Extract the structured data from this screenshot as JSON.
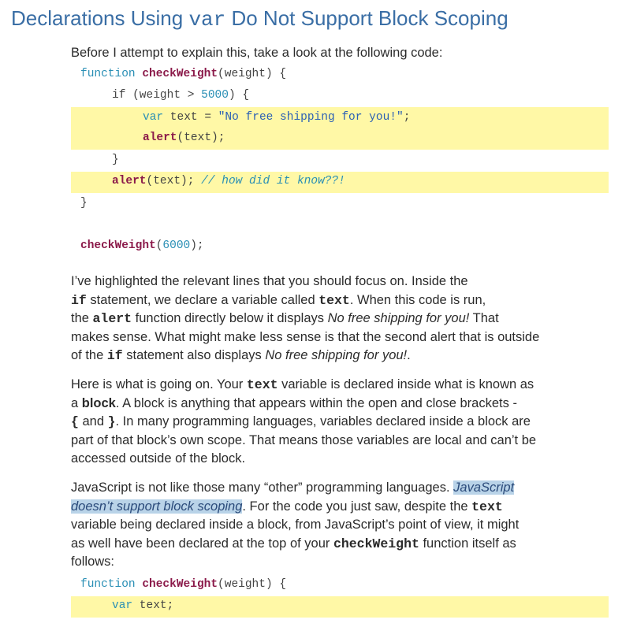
{
  "heading": {
    "pre": "Declarations Using ",
    "code": "var",
    "post": " Do Not Support Block Scoping"
  },
  "intro": "Before I attempt to explain this, take a look at the following code:",
  "code1": {
    "l1_kw": "function",
    "l1_fn": "checkWeight",
    "l1_rest": "(weight) {",
    "l2_a": "if (weight > ",
    "l2_num": "5000",
    "l2_b": ") {",
    "l3_kw": "var",
    "l3_a": " text = ",
    "l3_str": "\"No free shipping for you!\"",
    "l3_b": ";",
    "l4_fn": "alert",
    "l4_rest": "(text);",
    "l5": "}",
    "l6_fn": "alert",
    "l6_rest": "(text); ",
    "l6_cm": "// how did it know??!",
    "l7": "}",
    "l8_fn": "checkWeight",
    "l8_a": "(",
    "l8_num": "6000",
    "l8_b": ");"
  },
  "p1": {
    "t1": "I’ve highlighted the relevant lines that you should focus on. Inside the",
    "c1": "if",
    "t2": " statement, we declare a variable called ",
    "c2": "text",
    "t3": ". When this code is run,",
    "t4": "the ",
    "c3": "alert",
    "t5": " function directly below it displays ",
    "i1": "No free shipping for you!",
    "t6": " That",
    "t7": "makes sense. What might make less sense is that the second alert that is outside",
    "t8": "of the ",
    "c4": "if",
    "t9": " statement also displays ",
    "i2": "No free shipping for you!",
    "t10": "."
  },
  "p2": {
    "t1": "Here is what is going on. Your ",
    "c1": "text",
    "t2": " variable is declared inside what is known as",
    "t3": "a ",
    "b1": "block",
    "t4": ". A block is anything that appears within the open and close brackets -",
    "c2": "{",
    "t5": " and ",
    "c3": "}",
    "t6": ". In many programming languages, variables declared inside a block are",
    "t7": "part of that block’s own scope. That means those variables are local and can’t be",
    "t8": "accessed outside of the block."
  },
  "p3": {
    "t1": "JavaScript is not like those many “other” programming languages. ",
    "sel1": "JavaScript",
    "sel2": "doesn’t support block scoping",
    "t2": ". For the code you just saw, despite the ",
    "c1": "text",
    "t3": "variable being declared inside a block, from JavaScript’s point of view, it might",
    "t4": "as well have been declared at the top of your ",
    "c2": "checkWeight",
    "t5": " function itself as",
    "t6": "follows:"
  },
  "code2": {
    "l1_kw": "function",
    "l1_fn": "checkWeight",
    "l1_rest": "(weight) {",
    "l2_kw": "var",
    "l2_rest": " text;"
  },
  "colors": {
    "heading": "#3a6ea5",
    "highlight": "#fff8a6",
    "keyword": "#2a8fb5",
    "function": "#8b1a4a",
    "selection": "#b9d3e8"
  }
}
